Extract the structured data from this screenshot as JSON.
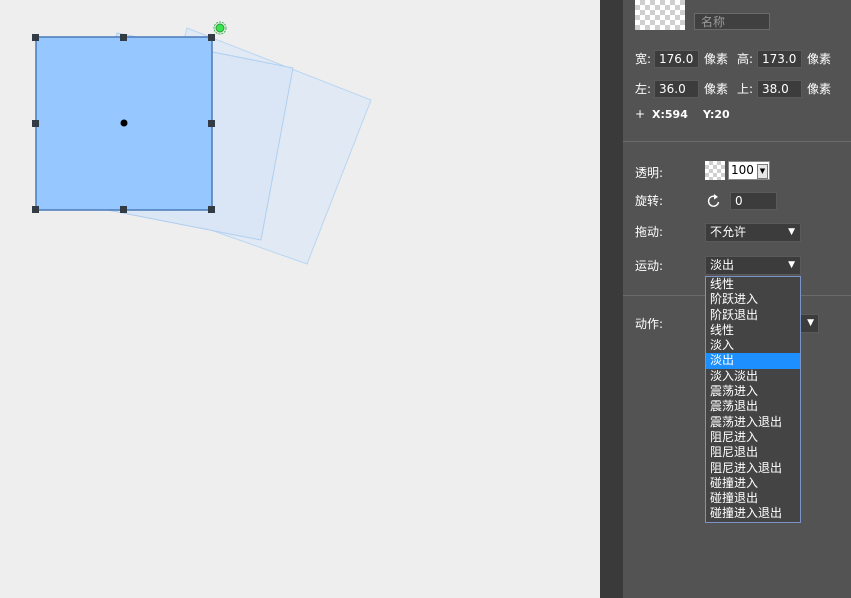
{
  "colors": {
    "canvas_bg": "#eeeeee",
    "panel_bg": "#535353",
    "shape_fill": "#96c8ff",
    "shape_border": "#4a7ab8",
    "ghost_fill": "#dfe8f4",
    "selected_option": "#1e8fff"
  },
  "canvas": {
    "shape": {
      "width_value": "176.0",
      "height_value": "173.0",
      "rotate_handle_icon": "rotate-handle-icon"
    }
  },
  "panel": {
    "name_placeholder": "名称",
    "width_label": "宽:",
    "width_value": "176.0",
    "height_label": "高:",
    "height_value": "173.0",
    "unit": "像素",
    "left_label": "左:",
    "left_value": "36.0",
    "top_label": "上:",
    "top_value": "38.0",
    "plus": "+",
    "x_readout": "X:594",
    "y_readout": "Y:20",
    "opacity_label": "透明:",
    "opacity_value": "100",
    "rotate_label": "旋转:",
    "rotate_value": "0",
    "drag_label": "拖动:",
    "drag_value": "不允许",
    "motion_label": "运动:",
    "motion_value": "淡出",
    "action_label": "动作:"
  },
  "motion_options": [
    {
      "label": "线性",
      "selected": false
    },
    {
      "label": "阶跃进入",
      "selected": false
    },
    {
      "label": "阶跃退出",
      "selected": false
    },
    {
      "label": "线性",
      "selected": false
    },
    {
      "label": "淡入",
      "selected": false
    },
    {
      "label": "淡出",
      "selected": true
    },
    {
      "label": "淡入淡出",
      "selected": false
    },
    {
      "label": "震荡进入",
      "selected": false
    },
    {
      "label": "震荡退出",
      "selected": false
    },
    {
      "label": "震荡进入退出",
      "selected": false
    },
    {
      "label": "阻尼进入",
      "selected": false
    },
    {
      "label": "阻尼退出",
      "selected": false
    },
    {
      "label": "阻尼进入退出",
      "selected": false
    },
    {
      "label": "碰撞进入",
      "selected": false
    },
    {
      "label": "碰撞退出",
      "selected": false
    },
    {
      "label": "碰撞进入退出",
      "selected": false
    }
  ]
}
